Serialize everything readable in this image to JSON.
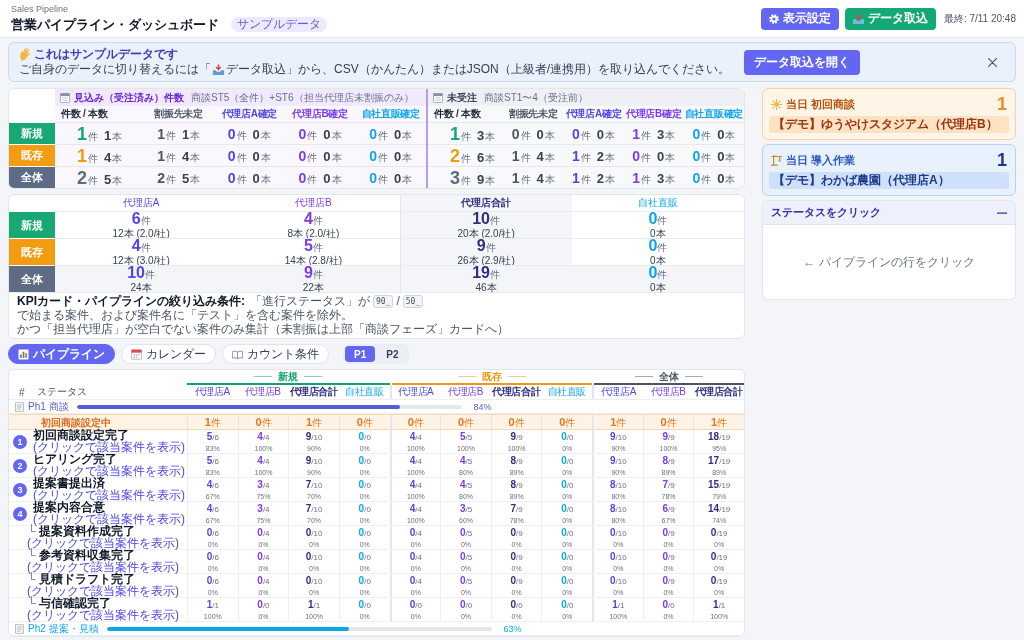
{
  "header": {
    "app_label": "Sales Pipeline",
    "title": "営業パイプライン・ダッシュボード",
    "badge": "サンプルデータ",
    "buttons": [
      {
        "label": "表示設定",
        "kind": "settings"
      },
      {
        "label": "データ取込",
        "kind": "import"
      }
    ],
    "last_updated": "最終: 7/11 20:48"
  },
  "banner": {
    "title": "これはサンプルデータです",
    "text_before": "ご自身のデータに切り替えるには「",
    "text_after": "データ取込」から、CSV（かんたん）またはJSON（上級者/連携用）を取り込んでください。",
    "button": "データ取込を開く"
  },
  "kpi_summary": {
    "rows": [
      {
        "label": "新規",
        "color": "#18a873"
      },
      {
        "label": "既存",
        "color": "#f39c12"
      },
      {
        "label": "全体",
        "color": "#5d6b84"
      }
    ],
    "groups": [
      {
        "kind": "won",
        "title": "見込み（受注済み）件数",
        "note": "商談ST5（全件）+ST6（担当代理店未割振のみ）",
        "columns": [
          {
            "label": "件数 / 本数",
            "kind": "main"
          },
          {
            "label": "割振先未定",
            "kind": "unassigned"
          },
          {
            "label": "代理店A確定",
            "kind": "a"
          },
          {
            "label": "代理店B確定",
            "kind": "b"
          },
          {
            "label": "自社直販確定",
            "kind": "direct"
          }
        ],
        "cells": [
          [
            {
              "count": "1",
              "count_unit": "件",
              "lines": "1",
              "lines_unit": "本"
            },
            {
              "count": "1",
              "count_unit": "件",
              "lines": "1",
              "lines_unit": "本"
            },
            {
              "count": "0",
              "count_unit": "件",
              "lines": "0",
              "lines_unit": "本"
            },
            {
              "count": "0",
              "count_unit": "件",
              "lines": "0",
              "lines_unit": "本"
            },
            {
              "count": "0",
              "count_unit": "件",
              "lines": "0",
              "lines_unit": "本"
            }
          ],
          [
            {
              "count": "1",
              "count_unit": "件",
              "lines": "4",
              "lines_unit": "本"
            },
            {
              "count": "1",
              "count_unit": "件",
              "lines": "4",
              "lines_unit": "本"
            },
            {
              "count": "0",
              "count_unit": "件",
              "lines": "0",
              "lines_unit": "本"
            },
            {
              "count": "0",
              "count_unit": "件",
              "lines": "0",
              "lines_unit": "本"
            },
            {
              "count": "0",
              "count_unit": "件",
              "lines": "0",
              "lines_unit": "本"
            }
          ],
          [
            {
              "count": "2",
              "count_unit": "件",
              "lines": "5",
              "lines_unit": "本"
            },
            {
              "count": "2",
              "count_unit": "件",
              "lines": "5",
              "lines_unit": "本"
            },
            {
              "count": "0",
              "count_unit": "件",
              "lines": "0",
              "lines_unit": "本"
            },
            {
              "count": "0",
              "count_unit": "件",
              "lines": "0",
              "lines_unit": "本"
            },
            {
              "count": "0",
              "count_unit": "件",
              "lines": "0",
              "lines_unit": "本"
            }
          ]
        ]
      },
      {
        "kind": "open",
        "title": "未受注",
        "note": "商談ST1〜4（受注前）",
        "columns": [
          {
            "label": "件数 / 本数",
            "kind": "main"
          },
          {
            "label": "割振先未定",
            "kind": "unassigned"
          },
          {
            "label": "代理店A確定",
            "kind": "a"
          },
          {
            "label": "代理店B確定",
            "kind": "b"
          },
          {
            "label": "自社直販確定",
            "kind": "direct"
          }
        ],
        "cells": [
          [
            {
              "count": "1",
              "count_unit": "件",
              "lines": "3",
              "lines_unit": "本"
            },
            {
              "count": "0",
              "count_unit": "件",
              "lines": "0",
              "lines_unit": "本"
            },
            {
              "count": "0",
              "count_unit": "件",
              "lines": "0",
              "lines_unit": "本"
            },
            {
              "count": "1",
              "count_unit": "件",
              "lines": "3",
              "lines_unit": "本"
            },
            {
              "count": "0",
              "count_unit": "件",
              "lines": "0",
              "lines_unit": "本"
            }
          ],
          [
            {
              "count": "2",
              "count_unit": "件",
              "lines": "6",
              "lines_unit": "本"
            },
            {
              "count": "1",
              "count_unit": "件",
              "lines": "4",
              "lines_unit": "本"
            },
            {
              "count": "1",
              "count_unit": "件",
              "lines": "2",
              "lines_unit": "本"
            },
            {
              "count": "0",
              "count_unit": "件",
              "lines": "0",
              "lines_unit": "本"
            },
            {
              "count": "0",
              "count_unit": "件",
              "lines": "0",
              "lines_unit": "本"
            }
          ],
          [
            {
              "count": "3",
              "count_unit": "件",
              "lines": "9",
              "lines_unit": "本"
            },
            {
              "count": "1",
              "count_unit": "件",
              "lines": "4",
              "lines_unit": "本"
            },
            {
              "count": "1",
              "count_unit": "件",
              "lines": "2",
              "lines_unit": "本"
            },
            {
              "count": "1",
              "count_unit": "件",
              "lines": "3",
              "lines_unit": "本"
            },
            {
              "count": "0",
              "count_unit": "件",
              "lines": "0",
              "lines_unit": "本"
            }
          ]
        ]
      }
    ]
  },
  "kpi_agency": {
    "columns": [
      {
        "label": "代理店A",
        "kind": "a"
      },
      {
        "label": "代理店B",
        "kind": "b"
      },
      {
        "label": "代理店合計",
        "kind": "total"
      },
      {
        "label": "自社直販",
        "kind": "direct"
      }
    ],
    "rows": [
      {
        "label": "新規",
        "color": "#18a873",
        "kind": "segment",
        "cells": [
          {
            "count": "6",
            "unit": "件",
            "detail": "12本 (2.0/社)"
          },
          {
            "count": "4",
            "unit": "件",
            "detail": "8本 (2.0/社)"
          },
          {
            "count": "10",
            "unit": "件",
            "detail": "20本 (2.0/社)"
          },
          {
            "count": "0",
            "unit": "件",
            "detail": "0本"
          }
        ]
      },
      {
        "label": "既存",
        "color": "#f39c12",
        "kind": "segment",
        "cells": [
          {
            "count": "4",
            "unit": "件",
            "detail": "12本 (3.0/社)"
          },
          {
            "count": "5",
            "unit": "件",
            "detail": "14本 (2.8/社)"
          },
          {
            "count": "9",
            "unit": "件",
            "detail": "26本 (2.9/社)"
          },
          {
            "count": "0",
            "unit": "件",
            "detail": "0本"
          }
        ]
      },
      {
        "label": "全体",
        "color": "#5d6b84",
        "kind": "total",
        "cells": [
          {
            "count": "10",
            "unit": "件",
            "detail": "24本"
          },
          {
            "count": "9",
            "unit": "件",
            "detail": "22本"
          },
          {
            "count": "19",
            "unit": "件",
            "detail": "46本"
          },
          {
            "count": "0",
            "unit": "件",
            "detail": "0本"
          }
        ]
      }
    ],
    "filter_note": {
      "label": "KPIカード・パイプラインの絞り込み条件:",
      "parts": [
        {
          "kind": "text",
          "text": "「進行ステータス」が"
        },
        {
          "kind": "code",
          "text": "90_"
        },
        {
          "kind": "text",
          "text": "/"
        },
        {
          "kind": "code",
          "text": "50_"
        },
        {
          "kind": "text",
          "text": "で始まる案件、および案件名に「テスト」を含む案件を除外。"
        },
        {
          "kind": "text",
          "text": "かつ「担当代理店」が空白でない案件のみ集計（未割振は上部「商談フェーズ」カードへ）"
        }
      ]
    }
  },
  "tabs": [
    {
      "label": "パイプライン",
      "kind": "pipeline",
      "selected": true
    },
    {
      "label": "カレンダー",
      "kind": "calendar",
      "selected": false
    },
    {
      "label": "カウント条件",
      "kind": "conditions",
      "selected": false
    }
  ],
  "pages": [
    {
      "label": "P1",
      "selected": true
    },
    {
      "label": "P2",
      "selected": false
    }
  ],
  "pipeline": {
    "index_header": "#",
    "status_header": "ステータス",
    "groups": [
      {
        "title": "新規",
        "color": "#12a26e",
        "columns": [
          {
            "label": "代理店A",
            "kind": "a"
          },
          {
            "label": "代理店B",
            "kind": "b"
          },
          {
            "label": "代理店合計",
            "kind": "total"
          },
          {
            "label": "自社直販",
            "kind": "direct"
          }
        ]
      },
      {
        "title": "既存",
        "color": "#eb9a12",
        "columns": [
          {
            "label": "代理店A",
            "kind": "a"
          },
          {
            "label": "代理店B",
            "kind": "b"
          },
          {
            "label": "代理店合計",
            "kind": "total"
          },
          {
            "label": "自社直販",
            "kind": "direct"
          }
        ]
      },
      {
        "title": "全体",
        "color": "#4b5563",
        "columns": [
          {
            "label": "代理店A",
            "kind": "a"
          },
          {
            "label": "代理店B",
            "kind": "b"
          },
          {
            "label": "代理店合計",
            "kind": "total"
          }
        ]
      }
    ],
    "phases": [
      {
        "title": "Ph1 商談",
        "color": "#5b5bd6",
        "level": 0.84,
        "reading": "84%",
        "rows": [
          {
            "kind": "waiting",
            "label": "初回商談設定中",
            "cells": [
              {
                "num": "1",
                "unit": "件"
              },
              {
                "num": "0",
                "unit": "件"
              },
              {
                "num": "1",
                "unit": "件"
              },
              {
                "num": "0",
                "unit": "件"
              },
              {
                "num": "0",
                "unit": "件"
              },
              {
                "num": "0",
                "unit": "件"
              },
              {
                "num": "0",
                "unit": "件"
              },
              {
                "num": "0",
                "unit": "件"
              },
              {
                "num": "1",
                "unit": "件"
              },
              {
                "num": "0",
                "unit": "件"
              },
              {
                "num": "1",
                "unit": "件"
              }
            ]
          },
          {
            "kind": "step",
            "number": "1",
            "label": "初回商談設定完了",
            "link": "(クリックで該当案件を表示)",
            "cells": [
              {
                "num": "5",
                "den": "/6",
                "pct": "83%"
              },
              {
                "num": "4",
                "den": "/4",
                "pct": "100%"
              },
              {
                "num": "9",
                "den": "/10",
                "pct": "90%"
              },
              {
                "num": "0",
                "den": "/0",
                "pct": "0%"
              },
              {
                "num": "4",
                "den": "/4",
                "pct": "100%"
              },
              {
                "num": "5",
                "den": "/5",
                "pct": "100%"
              },
              {
                "num": "9",
                "den": "/9",
                "pct": "100%"
              },
              {
                "num": "0",
                "den": "/0",
                "pct": "0%"
              },
              {
                "num": "9",
                "den": "/10",
                "pct": "90%"
              },
              {
                "num": "9",
                "den": "/9",
                "pct": "100%"
              },
              {
                "num": "18",
                "den": "/19",
                "pct": "95%"
              }
            ]
          },
          {
            "kind": "step",
            "number": "2",
            "label": "ヒアリング完了",
            "link": "(クリックで該当案件を表示)",
            "cells": [
              {
                "num": "5",
                "den": "/6",
                "pct": "83%"
              },
              {
                "num": "4",
                "den": "/4",
                "pct": "100%"
              },
              {
                "num": "9",
                "den": "/10",
                "pct": "90%"
              },
              {
                "num": "0",
                "den": "/0",
                "pct": "0%"
              },
              {
                "num": "4",
                "den": "/4",
                "pct": "100%"
              },
              {
                "num": "4",
                "den": "/5",
                "pct": "80%"
              },
              {
                "num": "8",
                "den": "/9",
                "pct": "89%"
              },
              {
                "num": "0",
                "den": "/0",
                "pct": "0%"
              },
              {
                "num": "9",
                "den": "/10",
                "pct": "90%"
              },
              {
                "num": "8",
                "den": "/9",
                "pct": "89%"
              },
              {
                "num": "17",
                "den": "/19",
                "pct": "89%"
              }
            ]
          },
          {
            "kind": "step",
            "number": "3",
            "label": "提案書提出済",
            "link": "(クリックで該当案件を表示)",
            "cells": [
              {
                "num": "4",
                "den": "/6",
                "pct": "67%"
              },
              {
                "num": "3",
                "den": "/4",
                "pct": "75%"
              },
              {
                "num": "7",
                "den": "/10",
                "pct": "70%"
              },
              {
                "num": "0",
                "den": "/0",
                "pct": "0%"
              },
              {
                "num": "4",
                "den": "/4",
                "pct": "100%"
              },
              {
                "num": "4",
                "den": "/5",
                "pct": "80%"
              },
              {
                "num": "8",
                "den": "/9",
                "pct": "89%"
              },
              {
                "num": "0",
                "den": "/0",
                "pct": "0%"
              },
              {
                "num": "8",
                "den": "/10",
                "pct": "80%"
              },
              {
                "num": "7",
                "den": "/9",
                "pct": "78%"
              },
              {
                "num": "15",
                "den": "/19",
                "pct": "79%"
              }
            ]
          },
          {
            "kind": "step",
            "number": "4",
            "label": "提案内容合意",
            "link": "(クリックで該当案件を表示)",
            "cells": [
              {
                "num": "4",
                "den": "/6",
                "pct": "67%"
              },
              {
                "num": "3",
                "den": "/4",
                "pct": "75%"
              },
              {
                "num": "7",
                "den": "/10",
                "pct": "70%"
              },
              {
                "num": "0",
                "den": "/0",
                "pct": "0%"
              },
              {
                "num": "4",
                "den": "/4",
                "pct": "100%"
              },
              {
                "num": "3",
                "den": "/5",
                "pct": "60%"
              },
              {
                "num": "7",
                "den": "/9",
                "pct": "78%"
              },
              {
                "num": "0",
                "den": "/0",
                "pct": "0%"
              },
              {
                "num": "8",
                "den": "/10",
                "pct": "80%"
              },
              {
                "num": "6",
                "den": "/9",
                "pct": "67%"
              },
              {
                "num": "14",
                "den": "/19",
                "pct": "74%"
              }
            ],
            "children": [
              {
                "marker": "└",
                "label": "提案資料作成完了",
                "link": "(クリックで該当案件を表示)",
                "cells": [
                  {
                    "num": "0",
                    "den": "/6",
                    "pct": "0%"
                  },
                  {
                    "num": "0",
                    "den": "/4",
                    "pct": "0%"
                  },
                  {
                    "num": "0",
                    "den": "/10",
                    "pct": "0%"
                  },
                  {
                    "num": "0",
                    "den": "/0",
                    "pct": "0%"
                  },
                  {
                    "num": "0",
                    "den": "/4",
                    "pct": "0%"
                  },
                  {
                    "num": "0",
                    "den": "/5",
                    "pct": "0%"
                  },
                  {
                    "num": "0",
                    "den": "/9",
                    "pct": "0%"
                  },
                  {
                    "num": "0",
                    "den": "/0",
                    "pct": "0%"
                  },
                  {
                    "num": "0",
                    "den": "/10",
                    "pct": "0%"
                  },
                  {
                    "num": "0",
                    "den": "/9",
                    "pct": "0%"
                  },
                  {
                    "num": "0",
                    "den": "/19",
                    "pct": "0%"
                  }
                ]
              },
              {
                "marker": "└",
                "label": "参考資料収集完了",
                "link": "(クリックで該当案件を表示)",
                "cells": [
                  {
                    "num": "0",
                    "den": "/6",
                    "pct": "0%"
                  },
                  {
                    "num": "0",
                    "den": "/4",
                    "pct": "0%"
                  },
                  {
                    "num": "0",
                    "den": "/10",
                    "pct": "0%"
                  },
                  {
                    "num": "0",
                    "den": "/0",
                    "pct": "0%"
                  },
                  {
                    "num": "0",
                    "den": "/4",
                    "pct": "0%"
                  },
                  {
                    "num": "0",
                    "den": "/5",
                    "pct": "0%"
                  },
                  {
                    "num": "0",
                    "den": "/9",
                    "pct": "0%"
                  },
                  {
                    "num": "0",
                    "den": "/0",
                    "pct": "0%"
                  },
                  {
                    "num": "0",
                    "den": "/10",
                    "pct": "0%"
                  },
                  {
                    "num": "0",
                    "den": "/9",
                    "pct": "0%"
                  },
                  {
                    "num": "0",
                    "den": "/19",
                    "pct": "0%"
                  }
                ]
              },
              {
                "marker": "└",
                "label": "見積ドラフト完了",
                "link": "(クリックで該当案件を表示)",
                "cells": [
                  {
                    "num": "0",
                    "den": "/6",
                    "pct": "0%"
                  },
                  {
                    "num": "0",
                    "den": "/4",
                    "pct": "0%"
                  },
                  {
                    "num": "0",
                    "den": "/10",
                    "pct": "0%"
                  },
                  {
                    "num": "0",
                    "den": "/0",
                    "pct": "0%"
                  },
                  {
                    "num": "0",
                    "den": "/4",
                    "pct": "0%"
                  },
                  {
                    "num": "0",
                    "den": "/5",
                    "pct": "0%"
                  },
                  {
                    "num": "0",
                    "den": "/9",
                    "pct": "0%"
                  },
                  {
                    "num": "0",
                    "den": "/0",
                    "pct": "0%"
                  },
                  {
                    "num": "0",
                    "den": "/10",
                    "pct": "0%"
                  },
                  {
                    "num": "0",
                    "den": "/9",
                    "pct": "0%"
                  },
                  {
                    "num": "0",
                    "den": "/19",
                    "pct": "0%"
                  }
                ]
              },
              {
                "marker": "└",
                "label": "与信確認完了",
                "link": "(クリックで該当案件を表示)",
                "cells": [
                  {
                    "num": "1",
                    "den": "/1",
                    "pct": "100%"
                  },
                  {
                    "num": "0",
                    "den": "/0",
                    "pct": "0%"
                  },
                  {
                    "num": "1",
                    "den": "/1",
                    "pct": "100%"
                  },
                  {
                    "num": "0",
                    "den": "/0",
                    "pct": "0%"
                  },
                  {
                    "num": "0",
                    "den": "/0",
                    "pct": "0%"
                  },
                  {
                    "num": "0",
                    "den": "/0",
                    "pct": "0%"
                  },
                  {
                    "num": "0",
                    "den": "/0",
                    "pct": "0%"
                  },
                  {
                    "num": "0",
                    "den": "/0",
                    "pct": "0%"
                  },
                  {
                    "num": "1",
                    "den": "/1",
                    "pct": "100%"
                  },
                  {
                    "num": "0",
                    "den": "/0",
                    "pct": "0%"
                  },
                  {
                    "num": "1",
                    "den": "/1",
                    "pct": "100%"
                  }
                ]
              }
            ]
          }
        ]
      },
      {
        "title": "Ph2 提案・見積",
        "color": "#0ea5e9",
        "level": 0.63,
        "reading": "63%"
      }
    ]
  },
  "today_cards": [
    {
      "kind": "meeting",
      "title": "当日 初回商談",
      "count": "1",
      "item": "【デモ】ゆうやけスタジアム（代理店B）"
    },
    {
      "kind": "install",
      "title": "当日 導入作業",
      "count": "1",
      "item": "【デモ】わかば農園（代理店A）"
    }
  ],
  "status_panel": {
    "title": "ステータスをクリック",
    "hint": "← パイプラインの行をクリック"
  }
}
